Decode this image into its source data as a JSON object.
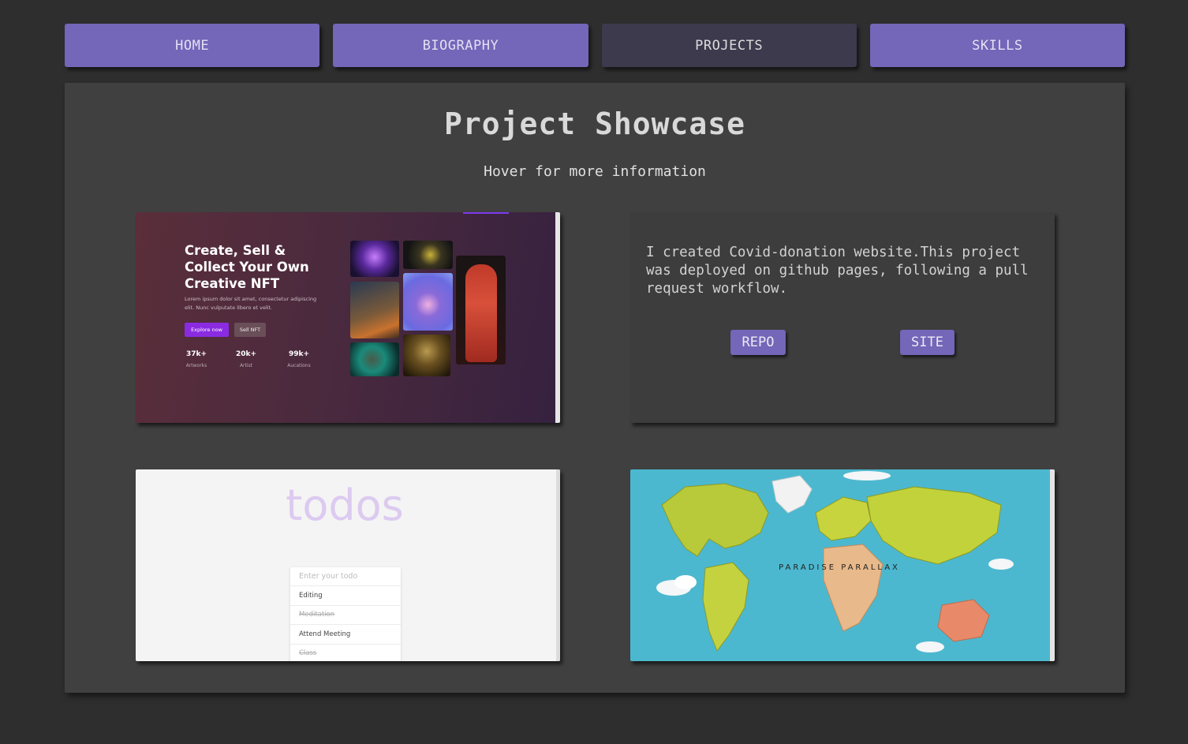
{
  "nav": {
    "items": [
      {
        "label": "HOME"
      },
      {
        "label": "BIOGRAPHY"
      },
      {
        "label": "PROJECTS"
      },
      {
        "label": "SKILLS"
      }
    ],
    "active": "PROJECTS"
  },
  "showcase": {
    "title": "Project Showcase",
    "subtitle": "Hover for more information"
  },
  "projects": [
    {
      "preview": {
        "heading": "Create, Sell & Collect Your Own Creative NFT",
        "paragraph": "Lorem ipsum dolor sit amet, consectetur adipiscing elit. Nunc vulputate libero et velit.",
        "primary_button": "Explore now",
        "secondary_button": "Sell NFT",
        "stats": [
          {
            "value": "37k+",
            "label": "Artworks"
          },
          {
            "value": "20k+",
            "label": "Artist"
          },
          {
            "value": "99k+",
            "label": "Aucations"
          }
        ]
      }
    },
    {
      "description": "I created Covid-donation website.This project was deployed on github pages, following a pull request workflow.",
      "repo_label": "REPO",
      "site_label": "SITE"
    },
    {
      "preview": {
        "title": "todos",
        "input_placeholder": "Enter your todo",
        "items": [
          {
            "text": "Editing",
            "done": false
          },
          {
            "text": "Meditation",
            "done": true
          },
          {
            "text": "Attend Meeting",
            "done": false
          },
          {
            "text": "Class",
            "done": true
          }
        ]
      }
    },
    {
      "preview": {
        "label": "PARADISE PARALLAX"
      }
    }
  ],
  "colors": {
    "background": "#2e2e2e",
    "panel": "#404040",
    "accent": "#7466b8",
    "active_tab": "#3d3a4e"
  }
}
